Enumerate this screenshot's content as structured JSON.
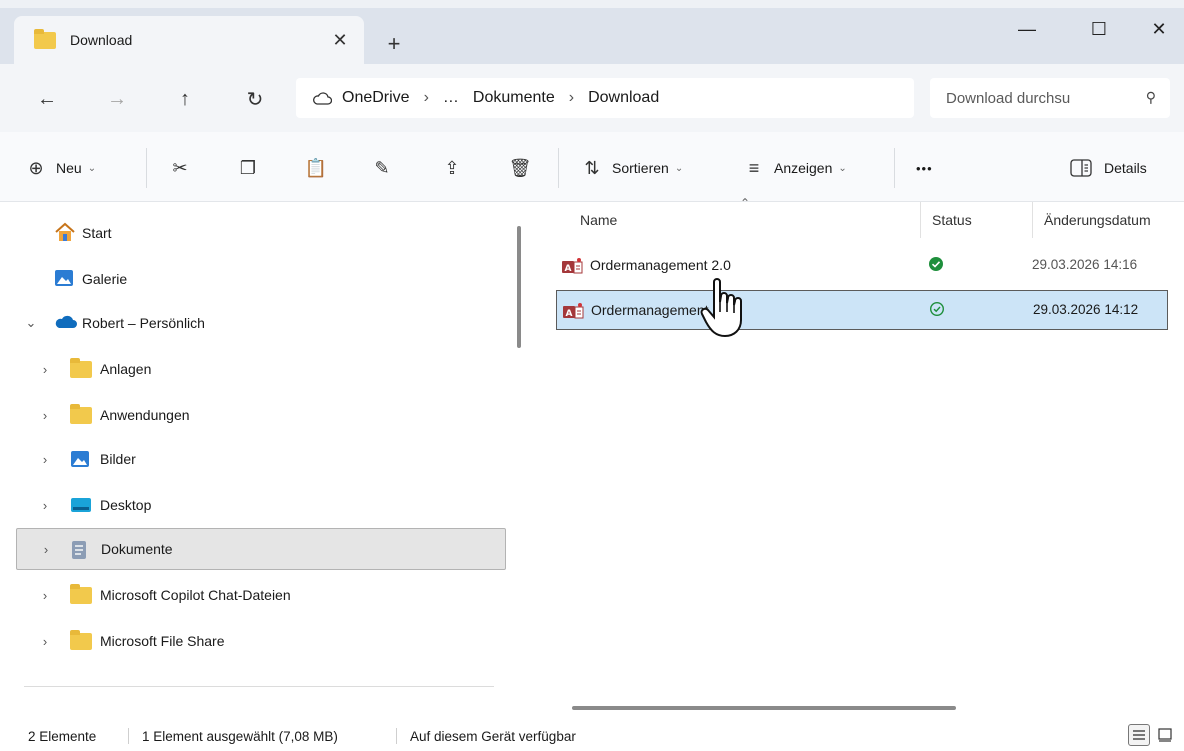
{
  "window": {
    "tab_title": "Download",
    "tab_close_glyph": "✕",
    "new_tab_glyph": "+",
    "minimize_glyph": "—",
    "maximize_glyph": "☐",
    "close_glyph": "✕"
  },
  "address": {
    "back_glyph": "←",
    "forward_glyph": "→",
    "up_glyph": "↑",
    "refresh_glyph": "↻",
    "crumbs": [
      "OneDrive",
      "…",
      "Dokumente",
      "Download"
    ],
    "separator": "›",
    "search_placeholder": "Download durchsu",
    "search_icon_glyph": "⚲"
  },
  "toolbar": {
    "new_label": "Neu",
    "sort_label": "Sortieren",
    "view_label": "Anzeigen",
    "more_label": "•••",
    "details_label": "Details",
    "chevron": "⌄",
    "icons": {
      "new": "⊕",
      "cut": "✂",
      "copy": "❐",
      "paste": "📋",
      "rename": "✎",
      "share": "⇪",
      "delete": "🗑",
      "sort": "⇅",
      "view": "≡"
    }
  },
  "nav": {
    "items": [
      {
        "label": "Start",
        "icon": "home-icon"
      },
      {
        "label": "Galerie",
        "icon": "gallery-icon"
      },
      {
        "label": "Robert – Persönlich",
        "icon": "onedrive-icon",
        "caret": "⌄"
      },
      {
        "label": "Anlagen",
        "icon": "folder-icon",
        "caret": "›"
      },
      {
        "label": "Anwendungen",
        "icon": "folder-icon",
        "caret": "›"
      },
      {
        "label": "Bilder",
        "icon": "pictures-icon",
        "caret": "›"
      },
      {
        "label": "Desktop",
        "icon": "desktop-icon",
        "caret": "›"
      },
      {
        "label": "Dokumente",
        "icon": "documents-icon",
        "caret": "›"
      },
      {
        "label": "Microsoft Copilot Chat-Dateien",
        "icon": "folder-icon",
        "caret": "›"
      },
      {
        "label": "Microsoft File Share",
        "icon": "folder-icon",
        "caret": "›"
      }
    ]
  },
  "files": {
    "columns": {
      "name": "Name",
      "status": "Status",
      "modified": "Änderungsdatum",
      "sort_caret": "⌃"
    },
    "rows": [
      {
        "name": "Ordermanagement 2.0",
        "status": "synced-filled",
        "modified": "29.03.2026 14:16"
      },
      {
        "name": "Ordermanagement",
        "status": "synced-outline",
        "modified": "29.03.2026 14:12"
      }
    ]
  },
  "status_bar": {
    "count": "2 Elemente",
    "selection": "1 Element ausgewählt (7,08 MB)",
    "availability": "Auf diesem Gerät verfügbar"
  },
  "colors": {
    "accent": "#0f6cbd",
    "selection": "#cce4f7",
    "synced_green": "#1e8f3c",
    "folder_yellow": "#f2c94c",
    "access_red": "#a4373a"
  }
}
